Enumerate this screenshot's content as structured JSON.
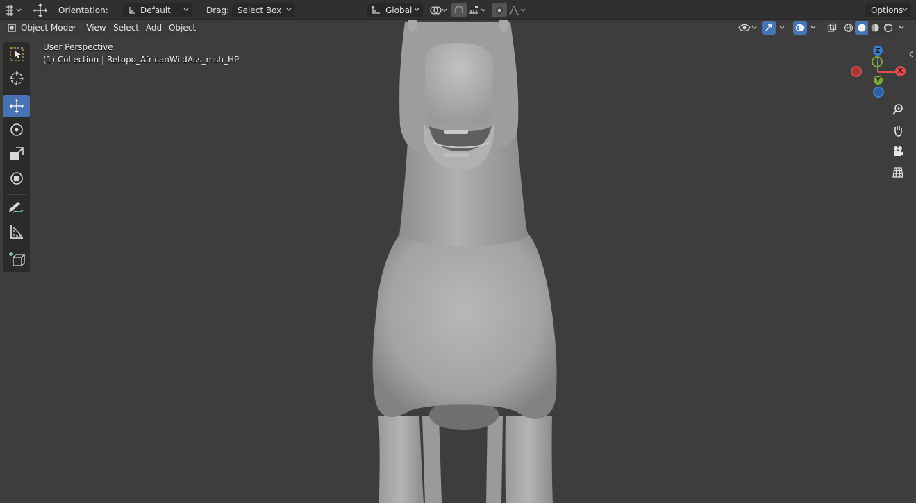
{
  "topbar": {
    "orientation_label": "Orientation:",
    "orientation_value": "Default",
    "drag_label": "Drag:",
    "drag_value": "Select Box",
    "transform_space": "Global",
    "options_label": "Options"
  },
  "header": {
    "mode": "Object Mode",
    "menu": [
      "View",
      "Select",
      "Add",
      "Object"
    ]
  },
  "viewport": {
    "view_name": "User Perspective",
    "collection_info": "(1) Collection | Retopo_AfricanWildAss_msh_HP"
  },
  "gizmo": {
    "z": "Z",
    "y": "Y",
    "x": "X",
    "colors": {
      "x": "#e34a4a",
      "y": "#7aa83a",
      "z": "#3b7fd0"
    }
  },
  "toolbar": {
    "tools": [
      "select-box",
      "cursor",
      "move",
      "rotate",
      "scale",
      "transform",
      "annotate",
      "measure",
      "add-cube"
    ],
    "active": "move"
  },
  "colors": {
    "accent": "#4772b3",
    "header_bg": "#303030",
    "viewport_bg": "#3d3d3d"
  }
}
